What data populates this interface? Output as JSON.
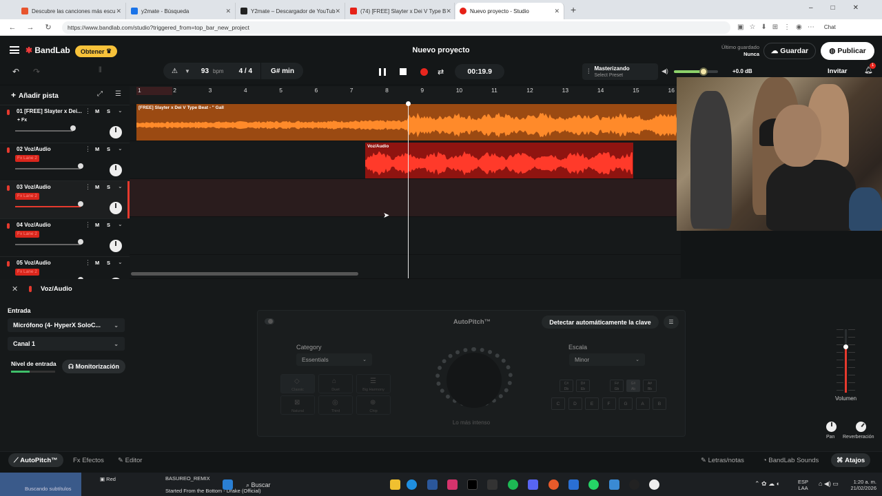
{
  "browser": {
    "tabs": [
      {
        "label": "Descubre las canciones más escu",
        "color": "#e8542e"
      },
      {
        "label": "y2mate - Búsqueda",
        "color": "#1a73e8"
      },
      {
        "label": "Y2mate – Descargador de YouTub",
        "color": "#222222"
      },
      {
        "label": "(74) [FREE] Slayter x Dei V Type B",
        "color": "#e62117"
      },
      {
        "label": "Nuevo proyecto - Studio",
        "color": "#e62117"
      }
    ],
    "new_tab": "+",
    "url": "https://www.bandlab.com/studio?triggered_from=top_bar_new_project",
    "chat_label": "Chat"
  },
  "app": {
    "logo": "BandLab",
    "get_label": "Obtener",
    "project_title": "Nuevo proyecto",
    "last_saved_label": "Último guardado",
    "last_saved_value": "Nunca",
    "save_label": "Guardar",
    "publish_label": "Publicar",
    "invite_label": "Invitar",
    "notif_count": "1"
  },
  "toolbar": {
    "bpm": "93",
    "bpm_label": "bpm",
    "time_sig": "4 / 4",
    "key": "G# min",
    "time": "00:19.9",
    "mastering_title": "Masterizando",
    "mastering_sub": "Select Preset",
    "master_db": "+0.0 dB",
    "master_volume": 0.66
  },
  "tracks": {
    "add_track": "Añadir pista",
    "items": [
      {
        "name": "01  [FREE] Slayter x Dei...",
        "fx": "+ Fx",
        "fx_style": "plain",
        "vol": 0.76
      },
      {
        "name": "02  Voz/Audio",
        "fx": "Fx  Lane 2",
        "fx_style": "red",
        "vol": 0.86
      },
      {
        "name": "03  Voz/Audio",
        "fx": "Fx  Lane 2",
        "fx_style": "red",
        "vol": 0.86
      },
      {
        "name": "04  Voz/Audio",
        "fx": "Fx  Lane 2",
        "fx_style": "red",
        "vol": 0.86
      },
      {
        "name": "05  Voz/Audio",
        "fx": "Fx  Lane 2",
        "fx_style": "red",
        "vol": 0.86
      }
    ],
    "mute": "M",
    "solo": "S"
  },
  "ruler": [
    "1",
    "2",
    "3",
    "4",
    "5",
    "6",
    "7",
    "8",
    "9",
    "10",
    "11",
    "12",
    "13",
    "14",
    "15",
    "16"
  ],
  "clips": {
    "beat": "[FREE] Slayter x Dei V Type Beat - \" Gall",
    "vocal": "Voz/Audio"
  },
  "panel": {
    "track_name": "Voz/Audio",
    "input_label": "Entrada",
    "input_device": "Micrófono (4- HyperX SoloC...",
    "channel": "Canal 1",
    "input_level_label": "Nivel de entrada",
    "monitor_label": "Monitorización",
    "autopitch_title": "AutoPitch™",
    "detect_key": "Detectar automáticamente la clave",
    "category_label": "Category",
    "category_value": "Essentials",
    "presets": [
      "Classic",
      "Duet",
      "Big Harmony",
      "Natural",
      "Third",
      "Chip"
    ],
    "dial_label": "Lo más intenso",
    "scale_label": "Escala",
    "scale_value": "Minor",
    "sharp_keys": [
      "C#\nDb",
      "D#\nEb",
      "F#\nGb",
      "G#\nAb",
      "A#\nBb"
    ],
    "natural_keys": [
      "C",
      "D",
      "E",
      "F",
      "G",
      "A",
      "B"
    ],
    "volume_label": "Volumen",
    "volume_level": 0.72,
    "pan_label": "Pan",
    "reverb_label": "Reverberación"
  },
  "bottom": {
    "autopitch": "AutoPitch™",
    "effects": "Efectos",
    "editor": "Editor",
    "lyrics": "Letras/notas",
    "sounds": "BandLab Sounds",
    "shortcuts": "Atajos"
  },
  "taskbar": {
    "thumb_label": "Buscando subtítulos",
    "red_label": "Red",
    "file1": "BASUREO_REMIX",
    "file2": "Started From the Bottom - Drake (Official)",
    "search": "Buscar",
    "lang1": "ESP",
    "lang2": "LAA",
    "clock": "1:20 a. m.",
    "date": "21/02/2026"
  }
}
